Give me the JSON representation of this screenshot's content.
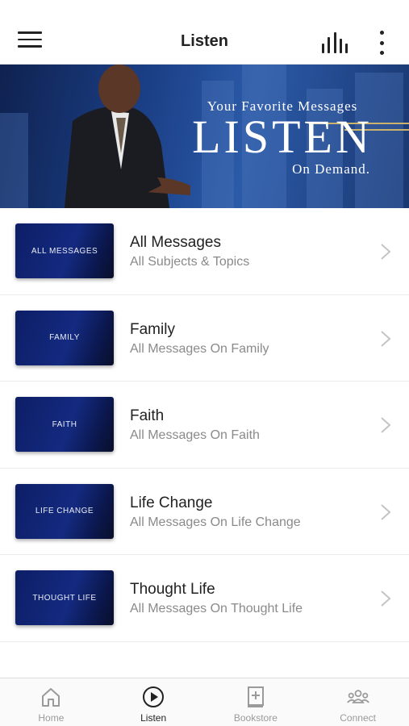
{
  "header": {
    "title": "Listen"
  },
  "banner": {
    "kicker": "Your Favorite Messages",
    "headline": "LISTEN",
    "subline": "On Demand."
  },
  "categories": [
    {
      "thumb_label": "ALL MESSAGES",
      "title": "All Messages",
      "subtitle": "All Subjects & Topics"
    },
    {
      "thumb_label": "FAMILY",
      "title": "Family",
      "subtitle": "All Messages On Family"
    },
    {
      "thumb_label": "FAITH",
      "title": "Faith",
      "subtitle": "All Messages On Faith"
    },
    {
      "thumb_label": "LIFE CHANGE",
      "title": "Life Change",
      "subtitle": "All Messages On Life Change"
    },
    {
      "thumb_label": "THOUGHT LIFE",
      "title": "Thought Life",
      "subtitle": "All Messages On Thought Life"
    }
  ],
  "tabs": [
    {
      "label": "Home",
      "icon": "home-icon",
      "active": false
    },
    {
      "label": "Listen",
      "icon": "play-circle-icon",
      "active": true
    },
    {
      "label": "Bookstore",
      "icon": "book-plus-icon",
      "active": false
    },
    {
      "label": "Connect",
      "icon": "group-icon",
      "active": false
    }
  ],
  "colors": {
    "accent": "#222222",
    "inactive_tab": "#9a9a9a",
    "thumb_bg": "#142a80",
    "banner_bg": "#1b3f86",
    "banner_stripe": "#c9b26b"
  }
}
